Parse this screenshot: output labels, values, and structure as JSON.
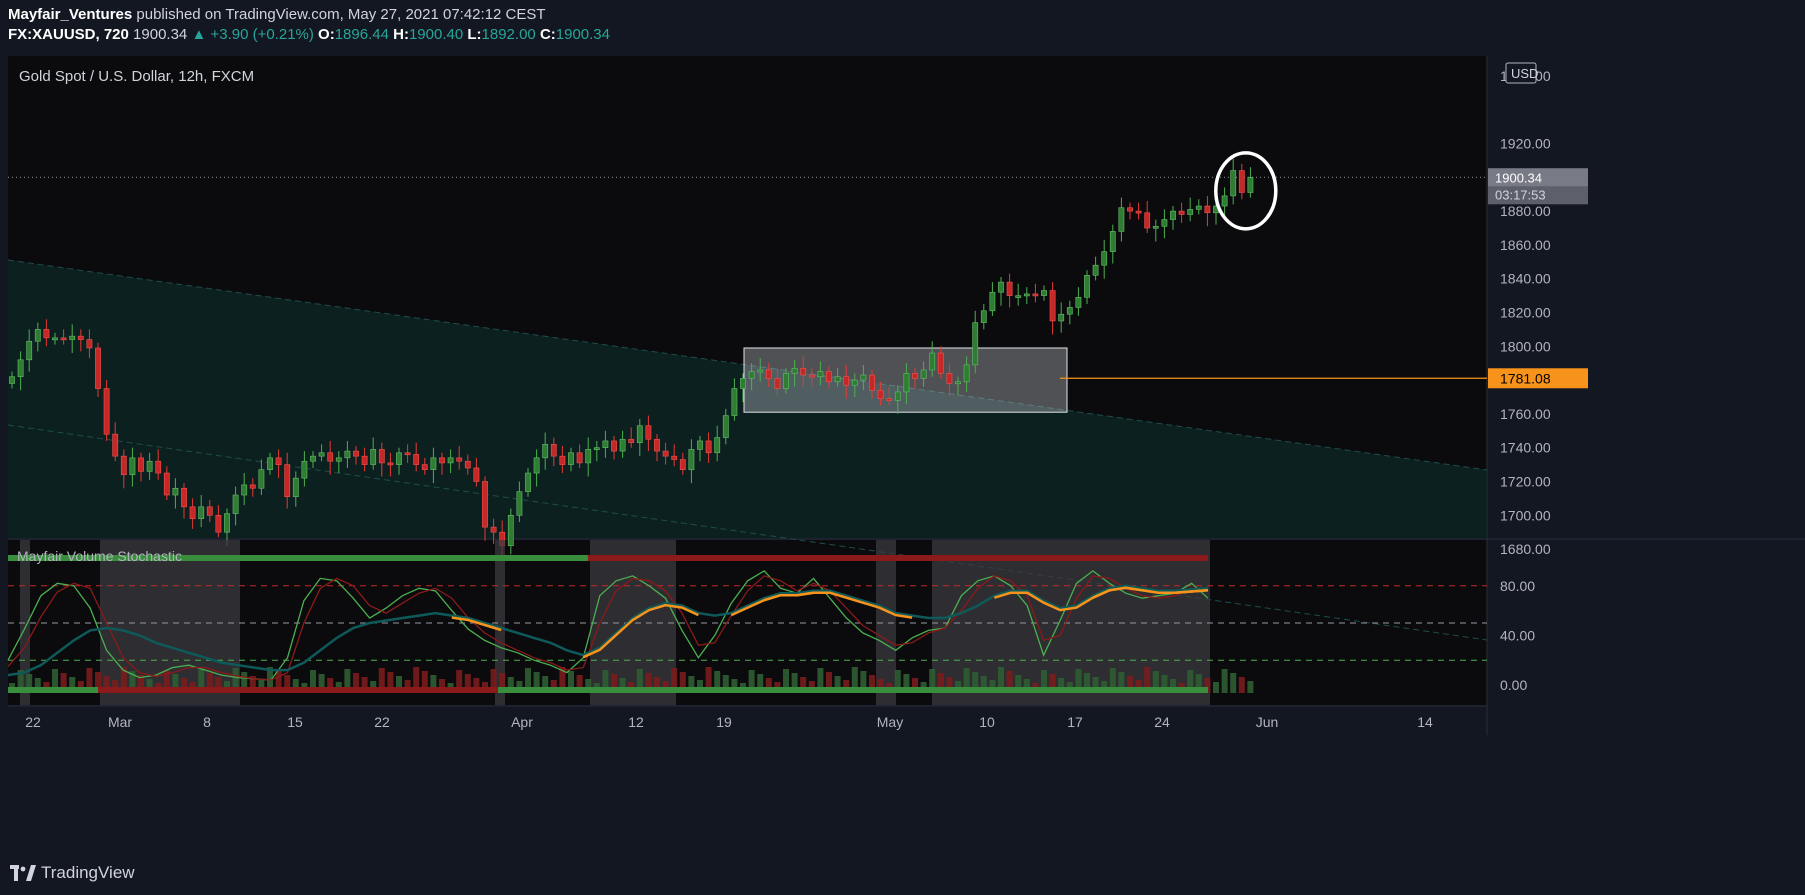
{
  "header": {
    "author": "Mayfair_Ventures",
    "published_text": "published on TradingView.com, May 27, 2021 07:42:12 CEST",
    "symbol": "FX:XAUUSD, 720",
    "last": "1900.34",
    "change": "▲ +3.90 (+0.21%)",
    "open_label": "O:",
    "open": "1896.44",
    "high_label": "H:",
    "high": "1900.40",
    "low_label": "L:",
    "low": "1892.00",
    "close_label": "C:",
    "close": "1900.34"
  },
  "footer": {
    "brand": "TradingView"
  },
  "colors": {
    "up": "#26a69a",
    "down": "#ef5350",
    "candle_up": "#2e7d32",
    "candle_down": "#c62828",
    "line_level": "#f7931a",
    "background": "#0b0b0d"
  },
  "chart_data": [
    {
      "type": "candlestick",
      "title": "Gold Spot / U.S. Dollar, 12h, FXCM",
      "currency": "USD",
      "y_ticks": [
        "1960.00",
        "1920.00",
        "1880.00",
        "1860.00",
        "1840.00",
        "1820.00",
        "1800.00",
        "1780.00",
        "1760.00",
        "1740.00",
        "1720.00",
        "1700.00",
        "1680.00"
      ],
      "ylim": [
        1672,
        1964
      ],
      "x_tick_labels": [
        "22",
        "Mar",
        "8",
        "15",
        "22",
        "Apr",
        "12",
        "19",
        "May",
        "10",
        "17",
        "24",
        "Jun",
        "14"
      ],
      "last_price_label": "1900.34",
      "countdown_label": "03:17:53",
      "level_price_label": "1781.08",
      "level_price": 1781.08,
      "range_box": {
        "low": 1761,
        "high": 1799
      },
      "annotation": "circle around last candles",
      "closes": [
        1782,
        1792,
        1803,
        1810,
        1805,
        1805,
        1804,
        1806,
        1804,
        1799,
        1775,
        1748,
        1735,
        1724,
        1734,
        1726,
        1732,
        1725,
        1712,
        1716,
        1705,
        1698,
        1705,
        1700,
        1690,
        1701,
        1712,
        1718,
        1716,
        1727,
        1734,
        1730,
        1711,
        1722,
        1732,
        1735,
        1737,
        1732,
        1734,
        1738,
        1735,
        1730,
        1739,
        1731,
        1730,
        1737,
        1736,
        1730,
        1727,
        1734,
        1731,
        1734,
        1732,
        1728,
        1720,
        1693,
        1690,
        1682,
        1700,
        1714,
        1725,
        1734,
        1742,
        1735,
        1730,
        1737,
        1731,
        1739,
        1740,
        1744,
        1738,
        1745,
        1743,
        1753,
        1745,
        1738,
        1735,
        1733,
        1727,
        1739,
        1744,
        1737,
        1746,
        1759,
        1775,
        1781,
        1785,
        1786,
        1781,
        1775,
        1784,
        1787,
        1783,
        1782,
        1785,
        1779,
        1782,
        1777,
        1780,
        1783,
        1774,
        1769,
        1768,
        1773,
        1784,
        1781,
        1786,
        1796,
        1784,
        1778,
        1779,
        1789,
        1814,
        1821,
        1832,
        1838,
        1830,
        1830,
        1831,
        1830,
        1833,
        1815,
        1819,
        1823,
        1829,
        1842,
        1848,
        1856,
        1868,
        1882,
        1880,
        1879,
        1870,
        1871,
        1875,
        1880,
        1878,
        1881,
        1883,
        1879,
        1883,
        1889,
        1904,
        1891,
        1900
      ]
    },
    {
      "type": "line",
      "title": "Mayfair Volume Stochastic",
      "y_ticks": [
        "80.00",
        "40.00",
        "0.00"
      ],
      "ylim": [
        -5,
        112
      ],
      "series": [
        {
          "values": [
            20,
            45,
            72,
            82,
            80,
            62,
            28,
            12,
            6,
            8,
            14,
            16,
            12,
            8,
            6,
            5,
            4,
            22,
            68,
            86,
            84,
            70,
            54,
            62,
            72,
            78,
            76,
            60,
            45,
            36,
            30,
            26,
            20,
            16,
            10,
            22,
            72,
            84,
            88,
            80,
            70,
            44,
            22,
            40,
            66,
            84,
            92,
            78,
            74,
            86,
            70,
            54,
            42,
            36,
            28,
            38,
            44,
            46,
            72,
            84,
            88,
            80,
            64,
            24,
            52,
            82,
            92,
            82,
            74,
            70,
            72,
            74,
            82,
            70
          ]
        },
        {
          "values": [
            15,
            30,
            55,
            75,
            82,
            78,
            50,
            22,
            10,
            7,
            10,
            14,
            14,
            10,
            7,
            5,
            4,
            10,
            50,
            78,
            86,
            80,
            64,
            58,
            66,
            74,
            78,
            70,
            54,
            42,
            34,
            28,
            22,
            18,
            12,
            14,
            50,
            76,
            86,
            84,
            76,
            58,
            32,
            34,
            56,
            76,
            88,
            84,
            76,
            82,
            76,
            62,
            48,
            40,
            32,
            34,
            42,
            46,
            60,
            78,
            88,
            84,
            72,
            36,
            40,
            70,
            88,
            86,
            78,
            72,
            70,
            72,
            78,
            76
          ]
        },
        {
          "values": [
            8,
            10,
            16,
            26,
            36,
            44,
            46,
            44,
            40,
            34,
            30,
            26,
            22,
            18,
            16,
            14,
            12,
            12,
            18,
            28,
            38,
            46,
            50,
            52,
            54,
            56,
            58,
            56,
            54,
            50,
            46,
            42,
            38,
            34,
            28,
            24,
            30,
            42,
            54,
            62,
            66,
            64,
            58,
            56,
            58,
            64,
            70,
            74,
            74,
            76,
            76,
            72,
            68,
            64,
            58,
            56,
            54,
            54,
            58,
            64,
            72,
            76,
            76,
            68,
            62,
            64,
            72,
            78,
            80,
            78,
            76,
            76,
            77,
            78
          ]
        }
      ]
    }
  ]
}
